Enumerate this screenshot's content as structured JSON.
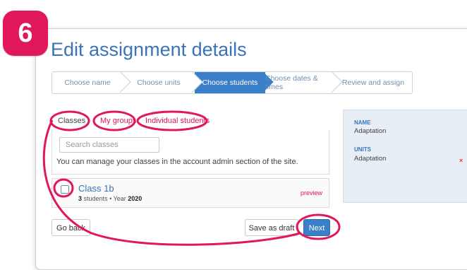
{
  "badge": {
    "step_number": "6"
  },
  "page": {
    "title": "Edit assignment details"
  },
  "stepper": {
    "steps": [
      {
        "label": "Choose name",
        "active": false
      },
      {
        "label": "Choose units",
        "active": false
      },
      {
        "label": "Choose students",
        "active": true
      },
      {
        "label": "Choose dates & times",
        "active": false
      },
      {
        "label": "Review and assign",
        "active": false
      }
    ]
  },
  "tabs": [
    {
      "label": "Classes",
      "active": true
    },
    {
      "label": "My groups",
      "active": false
    },
    {
      "label": "Individual students",
      "active": false
    }
  ],
  "search": {
    "placeholder": "Search classes"
  },
  "manage_note": "You can manage your classes in the account admin section of the site.",
  "class_row": {
    "name": "Class 1b",
    "student_count": "3",
    "students_label": "students",
    "bullet": "•",
    "year_label": "Year",
    "year": "2020",
    "preview_label": "preview",
    "checked": false
  },
  "buttons": {
    "back": "Go back",
    "save_draft": "Save as draft",
    "next": "Next"
  },
  "summary": {
    "name_label": "NAME",
    "name_value": "Adaptation",
    "units_label": "UNITS",
    "units_value": "Adaptation",
    "remove_glyph": "×"
  },
  "colors": {
    "accent": "#e0175a",
    "primary": "#3b7fc8",
    "link": "#3a73b8",
    "summary_bg": "#e8eef5"
  },
  "icons": {
    "step_separator": "chevron-right-icon",
    "remove": "close-icon"
  }
}
